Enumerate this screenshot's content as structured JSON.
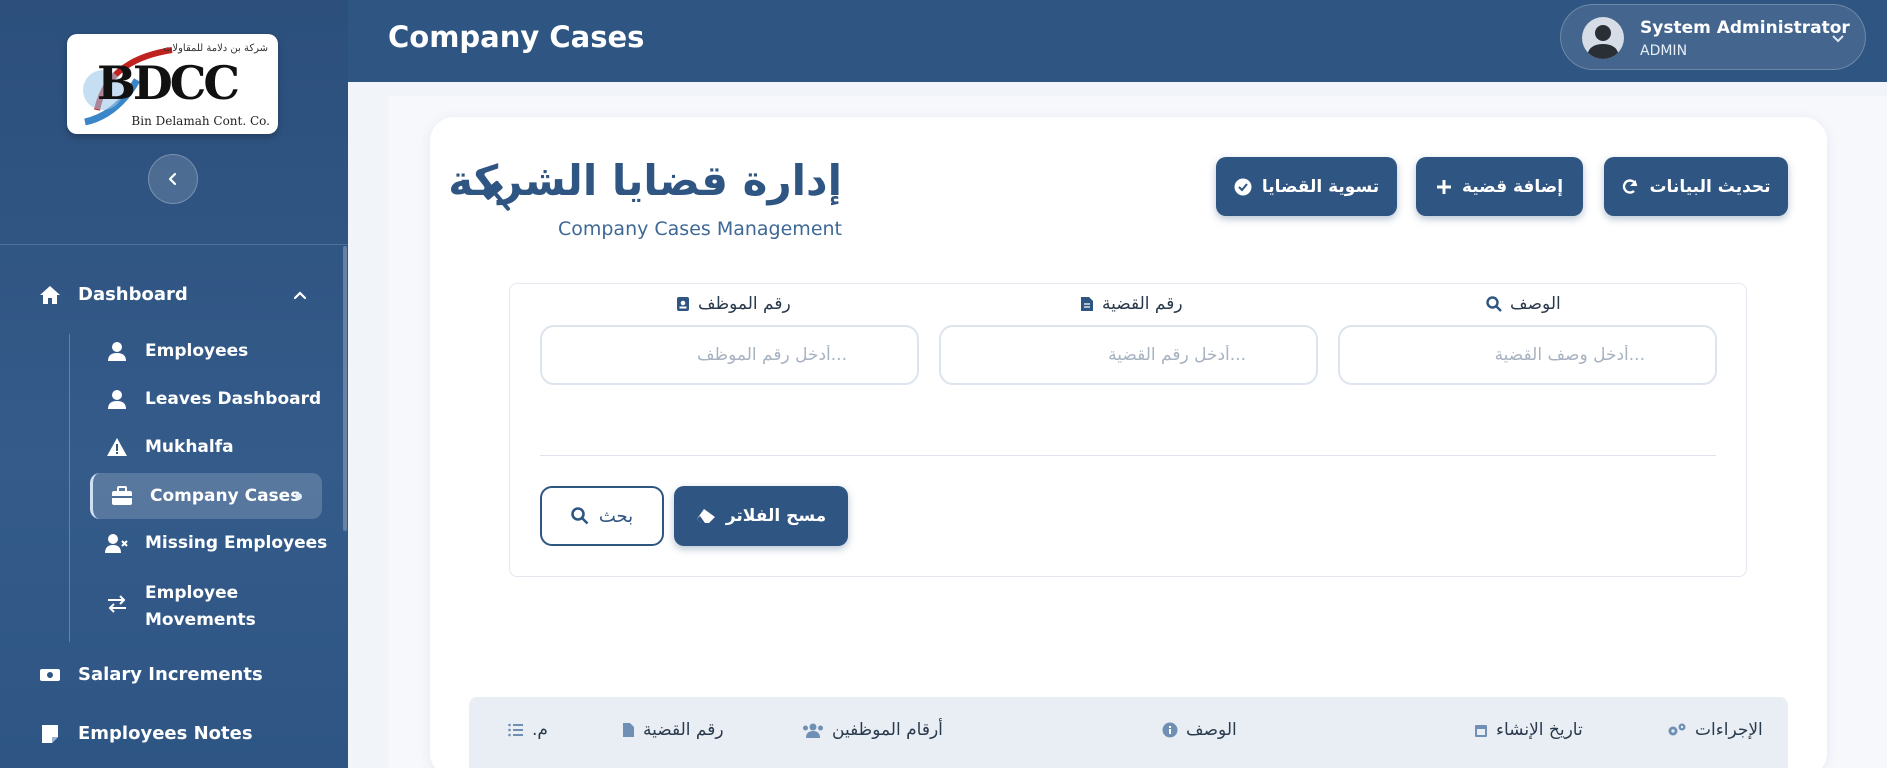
{
  "sidebar": {
    "logo": {
      "arabic": "شركة بن دلامة للمقاولات",
      "letters": "BDCC",
      "subtitle": "Bin Delamah Cont. Co."
    },
    "items": [
      {
        "label": "Dashboard",
        "icon": "home-icon"
      },
      {
        "label": "Employees",
        "icon": "user-icon"
      },
      {
        "label": "Leaves Dashboard",
        "icon": "user-icon"
      },
      {
        "label": "Mukhalfa",
        "icon": "warning-icon"
      },
      {
        "label": "Company Cases",
        "icon": "briefcase-icon",
        "active": true
      },
      {
        "label": "Missing Employees",
        "icon": "user-x-icon"
      },
      {
        "label": "Employee",
        "label2": "Movements",
        "icon": "exchange-icon"
      },
      {
        "label": "Salary Increments",
        "icon": "money-icon"
      },
      {
        "label": "Employees Notes",
        "icon": "note-icon"
      }
    ]
  },
  "header": {
    "title": "Company Cases",
    "user": {
      "name": "System Administrator",
      "role": "ADMIN"
    }
  },
  "main": {
    "title_ar": "إدارة قضايا الشركة",
    "title_en": "Company Cases Management",
    "actions": {
      "refresh": "تحديث البيانات",
      "add": "إضافة قضية",
      "settle": "تسوية القضايا"
    },
    "filters": {
      "description": {
        "label": "الوصف",
        "placeholder": "...أدخل وصف القضية"
      },
      "case_number": {
        "label": "رقم القضية",
        "placeholder": "...أدخل رقم القضية"
      },
      "employee_number": {
        "label": "رقم الموظف",
        "placeholder": "...أدخل رقم الموظف"
      }
    },
    "buttons": {
      "search": "بحث",
      "clear": "مسح الفلاتر"
    },
    "table": {
      "columns": [
        "الإجراءات",
        "تاريخ الإنشاء",
        "الوصف",
        "أرقام الموظفين",
        "رقم القضية",
        "م."
      ]
    }
  },
  "colors": {
    "primary": "#2f5582",
    "sidebar": "#2c4f7c",
    "accent_red": "#c0231f"
  }
}
